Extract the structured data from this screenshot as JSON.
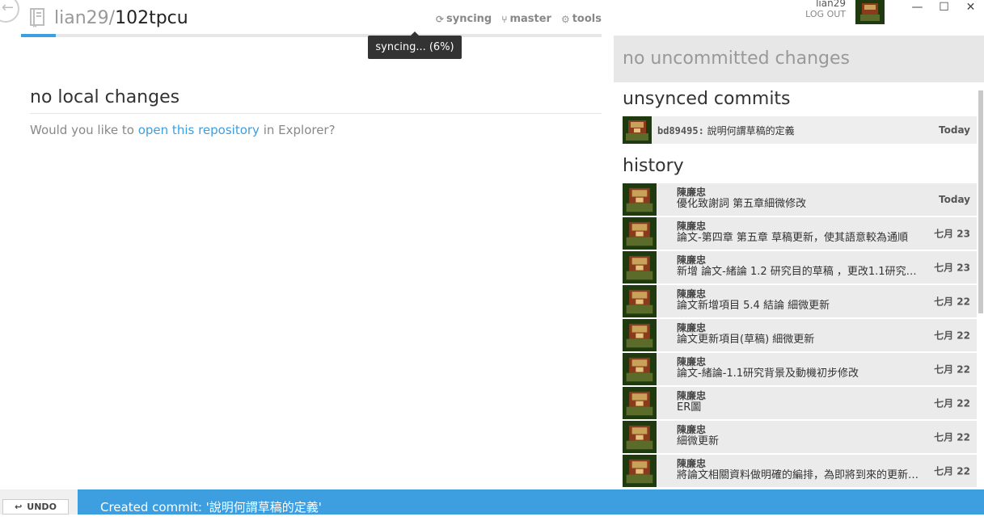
{
  "repo": {
    "owner": "lian29",
    "separator": "/",
    "name": "102tpcu"
  },
  "toolbar": {
    "sync_label": "syncing",
    "branch_label": "master",
    "tools_label": "tools"
  },
  "sync_progress": {
    "percent": 6,
    "tooltip": "syncing... (6%)"
  },
  "local": {
    "title": "no local changes",
    "prompt_prefix": "Would you like to ",
    "prompt_link": "open this repository",
    "prompt_suffix": " in Explorer?"
  },
  "account": {
    "username": "lian29",
    "logout": "LOG OUT"
  },
  "window": {
    "minimize": "—",
    "maximize": "☐",
    "close": "✕"
  },
  "uncommitted": "no uncommitted changes",
  "unsynced": {
    "title": "unsynced commits",
    "commits": [
      {
        "sha": "bd89495:",
        "message": " 說明何謂草稿的定義",
        "date": "Today"
      }
    ]
  },
  "history": {
    "title": "history",
    "commits": [
      {
        "author": "陳廉忠",
        "message": "優化致謝詞  第五章細微修改",
        "date": "Today"
      },
      {
        "author": "陳廉忠",
        "message": "論文-第四章 第五章 草稿更新，使其語意較為通順",
        "date": "七月 23"
      },
      {
        "author": "陳廉忠",
        "message": "新增 論文-緒論 1.2 研究目的草稿 ，更改1.1研究…",
        "date": "七月 23"
      },
      {
        "author": "陳廉忠",
        "message": "論文新增項目 5.4 結論 細微更新",
        "date": "七月 22"
      },
      {
        "author": "陳廉忠",
        "message": "論文更新項目(草稿) 細微更新",
        "date": "七月 22"
      },
      {
        "author": "陳廉忠",
        "message": "論文-緒論-1.1研究背景及動機初步修改",
        "date": "七月 22"
      },
      {
        "author": "陳廉忠",
        "message": "ER圖",
        "date": "七月 22"
      },
      {
        "author": "陳廉忠",
        "message": "細微更新",
        "date": "七月 22"
      },
      {
        "author": "陳廉忠",
        "message": "將論文相關資料做明確的編排，為即將到來的更新…",
        "date": "七月 22"
      }
    ]
  },
  "bottom": {
    "undo_label": "UNDO",
    "status": "Created commit: '說明何謂草稿的定義'"
  },
  "colors": {
    "accent": "#3d9ee0",
    "row_bg": "#ebebeb",
    "uncommitted_bg": "#e7e7e7"
  },
  "icons": [
    "back-arrow-icon",
    "repo-book-icon",
    "sync-icon",
    "branch-icon",
    "gear-icon",
    "undo-arrow-icon"
  ]
}
